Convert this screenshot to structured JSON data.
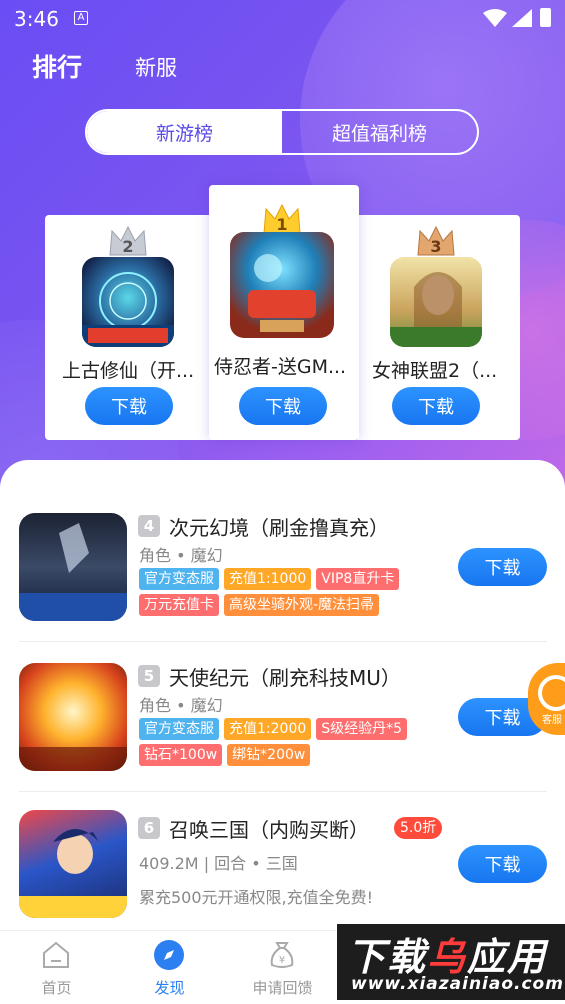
{
  "status_bar": {
    "time": "3:46",
    "notif_icon": "A"
  },
  "top_tabs": {
    "active": "排行",
    "other": "新服"
  },
  "segment": {
    "left": "新游榜",
    "right": "超值福利榜"
  },
  "podium": [
    {
      "rank": "2",
      "name": "上古修仙（开...",
      "button": "下载"
    },
    {
      "rank": "1",
      "name": "侍忍者-送GM...",
      "button": "下载"
    },
    {
      "rank": "3",
      "name": "女神联盟2（...",
      "button": "下载"
    }
  ],
  "list": [
    {
      "rank": "4",
      "title": "次元幻境（刷金撸真充）",
      "meta": "角色 • 魔幻",
      "tags_row1": [
        "官方变态服",
        "充值1:1000",
        "VIP8直升卡"
      ],
      "tags_row2": [
        "万元充值卡",
        "高级坐骑外观-魔法扫帚"
      ],
      "button": "下载"
    },
    {
      "rank": "5",
      "title": "天使纪元（刷充科技MU）",
      "meta": "角色 • 魔幻",
      "tags_row1": [
        "官方变态服",
        "充值1:2000",
        "S级经验丹*5"
      ],
      "tags_row2": [
        "钻石*100w",
        "绑钻*200w"
      ],
      "button": "下载"
    },
    {
      "rank": "6",
      "title": "召唤三国（内购买断）",
      "discount": "5.0折",
      "meta": "409.2M | 回合 • 三国",
      "desc": "累充500元开通权限,充值全免费!",
      "button": "下载"
    }
  ],
  "float_service": {
    "label": "客服"
  },
  "bottom_nav": [
    {
      "label": "首页",
      "icon": "home-icon"
    },
    {
      "label": "发现",
      "icon": "compass-icon"
    },
    {
      "label": "申请回馈",
      "icon": "money-bag-icon"
    }
  ],
  "watermark": {
    "title_a": "下载",
    "title_b": "乌",
    "title_c": "应用",
    "url": "www.xiazainiao.com"
  },
  "colors": {
    "accent": "#1776f0",
    "hero": "#6a4df4",
    "discount": "#ff4b3b"
  }
}
